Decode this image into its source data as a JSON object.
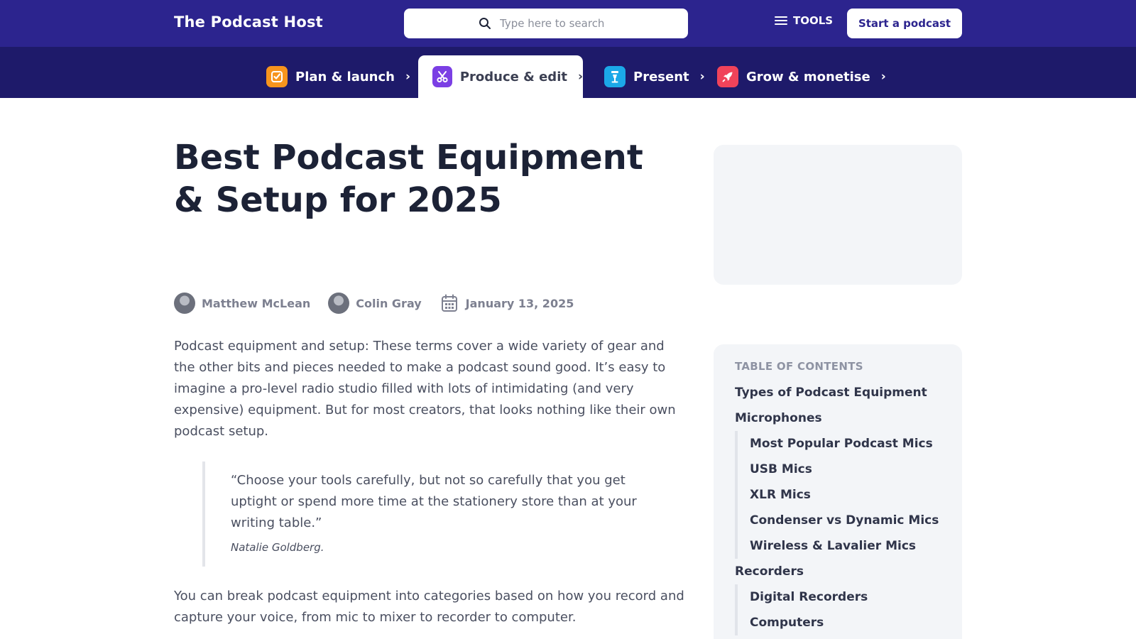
{
  "header": {
    "logo_text": "The Podcast Host",
    "search_placeholder": "Type here to search",
    "tools_label": "TOOLS",
    "cta_label": "Start a podcast"
  },
  "categories": [
    {
      "label": "Plan & launch",
      "icon": "checkbox-icon",
      "color": "#f7941d",
      "active": false
    },
    {
      "label": "Produce & edit",
      "icon": "scissors-icon",
      "color": "#7b3fe4",
      "active": true
    },
    {
      "label": "Present",
      "icon": "microphone-stand-icon",
      "color": "#1ba8e8",
      "active": false
    },
    {
      "label": "Grow & monetise",
      "icon": "rocket-icon",
      "color": "#f0435a",
      "active": false
    }
  ],
  "article": {
    "title": "Best Podcast Equipment & Setup for 2025",
    "authors": [
      "Matthew McLean",
      "Colin Gray"
    ],
    "date": "January 13, 2025",
    "intro": "Podcast equipment and setup: These terms cover a wide variety of gear and the other bits and pieces needed to make a podcast sound good. It’s easy to imagine a pro-level radio studio filled with lots of intimidating (and very expensive) equipment. But for most creators, that looks nothing like their own podcast setup.",
    "quote": "“Choose your tools carefully, but not so carefully that you get uptight or spend more time at the stationery store than at your writing table.”",
    "quote_author": "Natalie Goldberg.",
    "body": "You can break podcast equipment into categories based on how you record and capture your voice, from mic to mixer to recorder to computer."
  },
  "toc": {
    "heading": "TABLE OF CONTENTS",
    "item_1": "Types of Podcast Equipment",
    "item_2": "Microphones",
    "microphones_sub": [
      "Most Popular Podcast Mics",
      "USB Mics",
      "XLR Mics",
      "Condenser vs Dynamic Mics",
      "Wireless & Lavalier Mics"
    ],
    "item_3": "Recorders",
    "recorders_sub": [
      "Digital Recorders",
      "Computers"
    ]
  },
  "colors": {
    "header_bg": "#2c248e",
    "nav_bg": "#1e1a6a",
    "panel_bg": "#f3f5f8"
  }
}
